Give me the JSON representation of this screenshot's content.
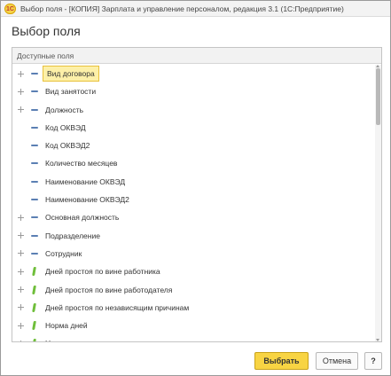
{
  "window": {
    "logo_text": "1С",
    "title": "Выбор поля - [КОПИЯ] Зарплата и управление персоналом, редакция 3.1  (1С:Предприятие)"
  },
  "dialog": {
    "title": "Выбор поля"
  },
  "list": {
    "header": "Доступные поля",
    "items": [
      {
        "label": "Вид договора",
        "expandable": true,
        "icon": "attribute-icon",
        "selected": true
      },
      {
        "label": "Вид занятости",
        "expandable": true,
        "icon": "attribute-icon",
        "selected": false
      },
      {
        "label": "Должность",
        "expandable": true,
        "icon": "attribute-icon",
        "selected": false
      },
      {
        "label": "Код ОКВЭД",
        "expandable": false,
        "icon": "attribute-icon",
        "selected": false
      },
      {
        "label": "Код ОКВЭД2",
        "expandable": false,
        "icon": "attribute-icon",
        "selected": false
      },
      {
        "label": "Количество месяцев",
        "expandable": false,
        "icon": "attribute-icon",
        "selected": false
      },
      {
        "label": "Наименование ОКВЭД",
        "expandable": false,
        "icon": "attribute-icon",
        "selected": false
      },
      {
        "label": "Наименование ОКВЭД2",
        "expandable": false,
        "icon": "attribute-icon",
        "selected": false
      },
      {
        "label": "Основная должность",
        "expandable": true,
        "icon": "attribute-icon",
        "selected": false
      },
      {
        "label": "Подразделение",
        "expandable": true,
        "icon": "attribute-icon",
        "selected": false
      },
      {
        "label": "Сотрудник",
        "expandable": true,
        "icon": "attribute-icon",
        "selected": false
      },
      {
        "label": "Дней простоя по вине работника",
        "expandable": true,
        "icon": "resource-icon",
        "selected": false
      },
      {
        "label": "Дней простоя по вине работодателя",
        "expandable": true,
        "icon": "resource-icon",
        "selected": false
      },
      {
        "label": "Дней простоя по независящим причинам",
        "expandable": true,
        "icon": "resource-icon",
        "selected": false
      },
      {
        "label": "Норма дней",
        "expandable": true,
        "icon": "resource-icon",
        "selected": false
      },
      {
        "label": "Норма часов",
        "expandable": true,
        "icon": "resource-icon",
        "selected": false
      }
    ]
  },
  "buttons": {
    "select": "Выбрать",
    "cancel": "Отмена",
    "help": "?"
  },
  "colors": {
    "accent": "#f8d443",
    "selection": "#fdf0a8",
    "attribute_icon": "#5b7fb3",
    "resource_icon": "#6fbe3a"
  }
}
